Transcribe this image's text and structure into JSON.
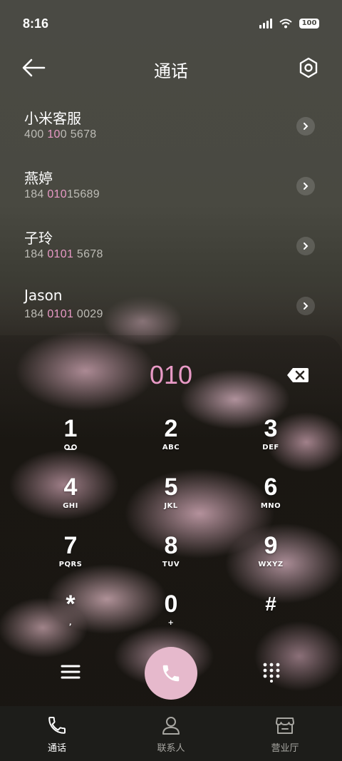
{
  "status_bar": {
    "time": "8:16",
    "battery": "100"
  },
  "header": {
    "title": "通话"
  },
  "contacts": [
    {
      "name": "小米客服",
      "number_pre": "400 ",
      "number_hl": "10",
      "number_post": "0 5678"
    },
    {
      "name": "燕婷",
      "number_pre": "184 ",
      "number_hl": "010",
      "number_post": "15689"
    },
    {
      "name": "子玲",
      "number_pre": "184 ",
      "number_hl": "0101",
      "number_post": " 5678"
    },
    {
      "name": "Jason",
      "number_pre": "184 ",
      "number_hl": "0101",
      "number_post": " 0029"
    }
  ],
  "dialer": {
    "input": "010",
    "keys": [
      {
        "digit": "1",
        "letters": ""
      },
      {
        "digit": "2",
        "letters": "ABC"
      },
      {
        "digit": "3",
        "letters": "DEF"
      },
      {
        "digit": "4",
        "letters": "GHI"
      },
      {
        "digit": "5",
        "letters": "JKL"
      },
      {
        "digit": "6",
        "letters": "MNO"
      },
      {
        "digit": "7",
        "letters": "PQRS"
      },
      {
        "digit": "8",
        "letters": "TUV"
      },
      {
        "digit": "9",
        "letters": "WXYZ"
      },
      {
        "digit": "*",
        "letters": ","
      },
      {
        "digit": "0",
        "letters": "+"
      },
      {
        "digit": "#",
        "letters": ""
      }
    ]
  },
  "nav": [
    {
      "label": "通话",
      "icon": "phone-icon",
      "active": true
    },
    {
      "label": "联系人",
      "icon": "person-icon",
      "active": false
    },
    {
      "label": "营业厅",
      "icon": "store-icon",
      "active": false
    }
  ],
  "colors": {
    "accent": "#e89ac6",
    "call_button": "#e6b9cc",
    "nav_bg": "#1d1d1a"
  }
}
